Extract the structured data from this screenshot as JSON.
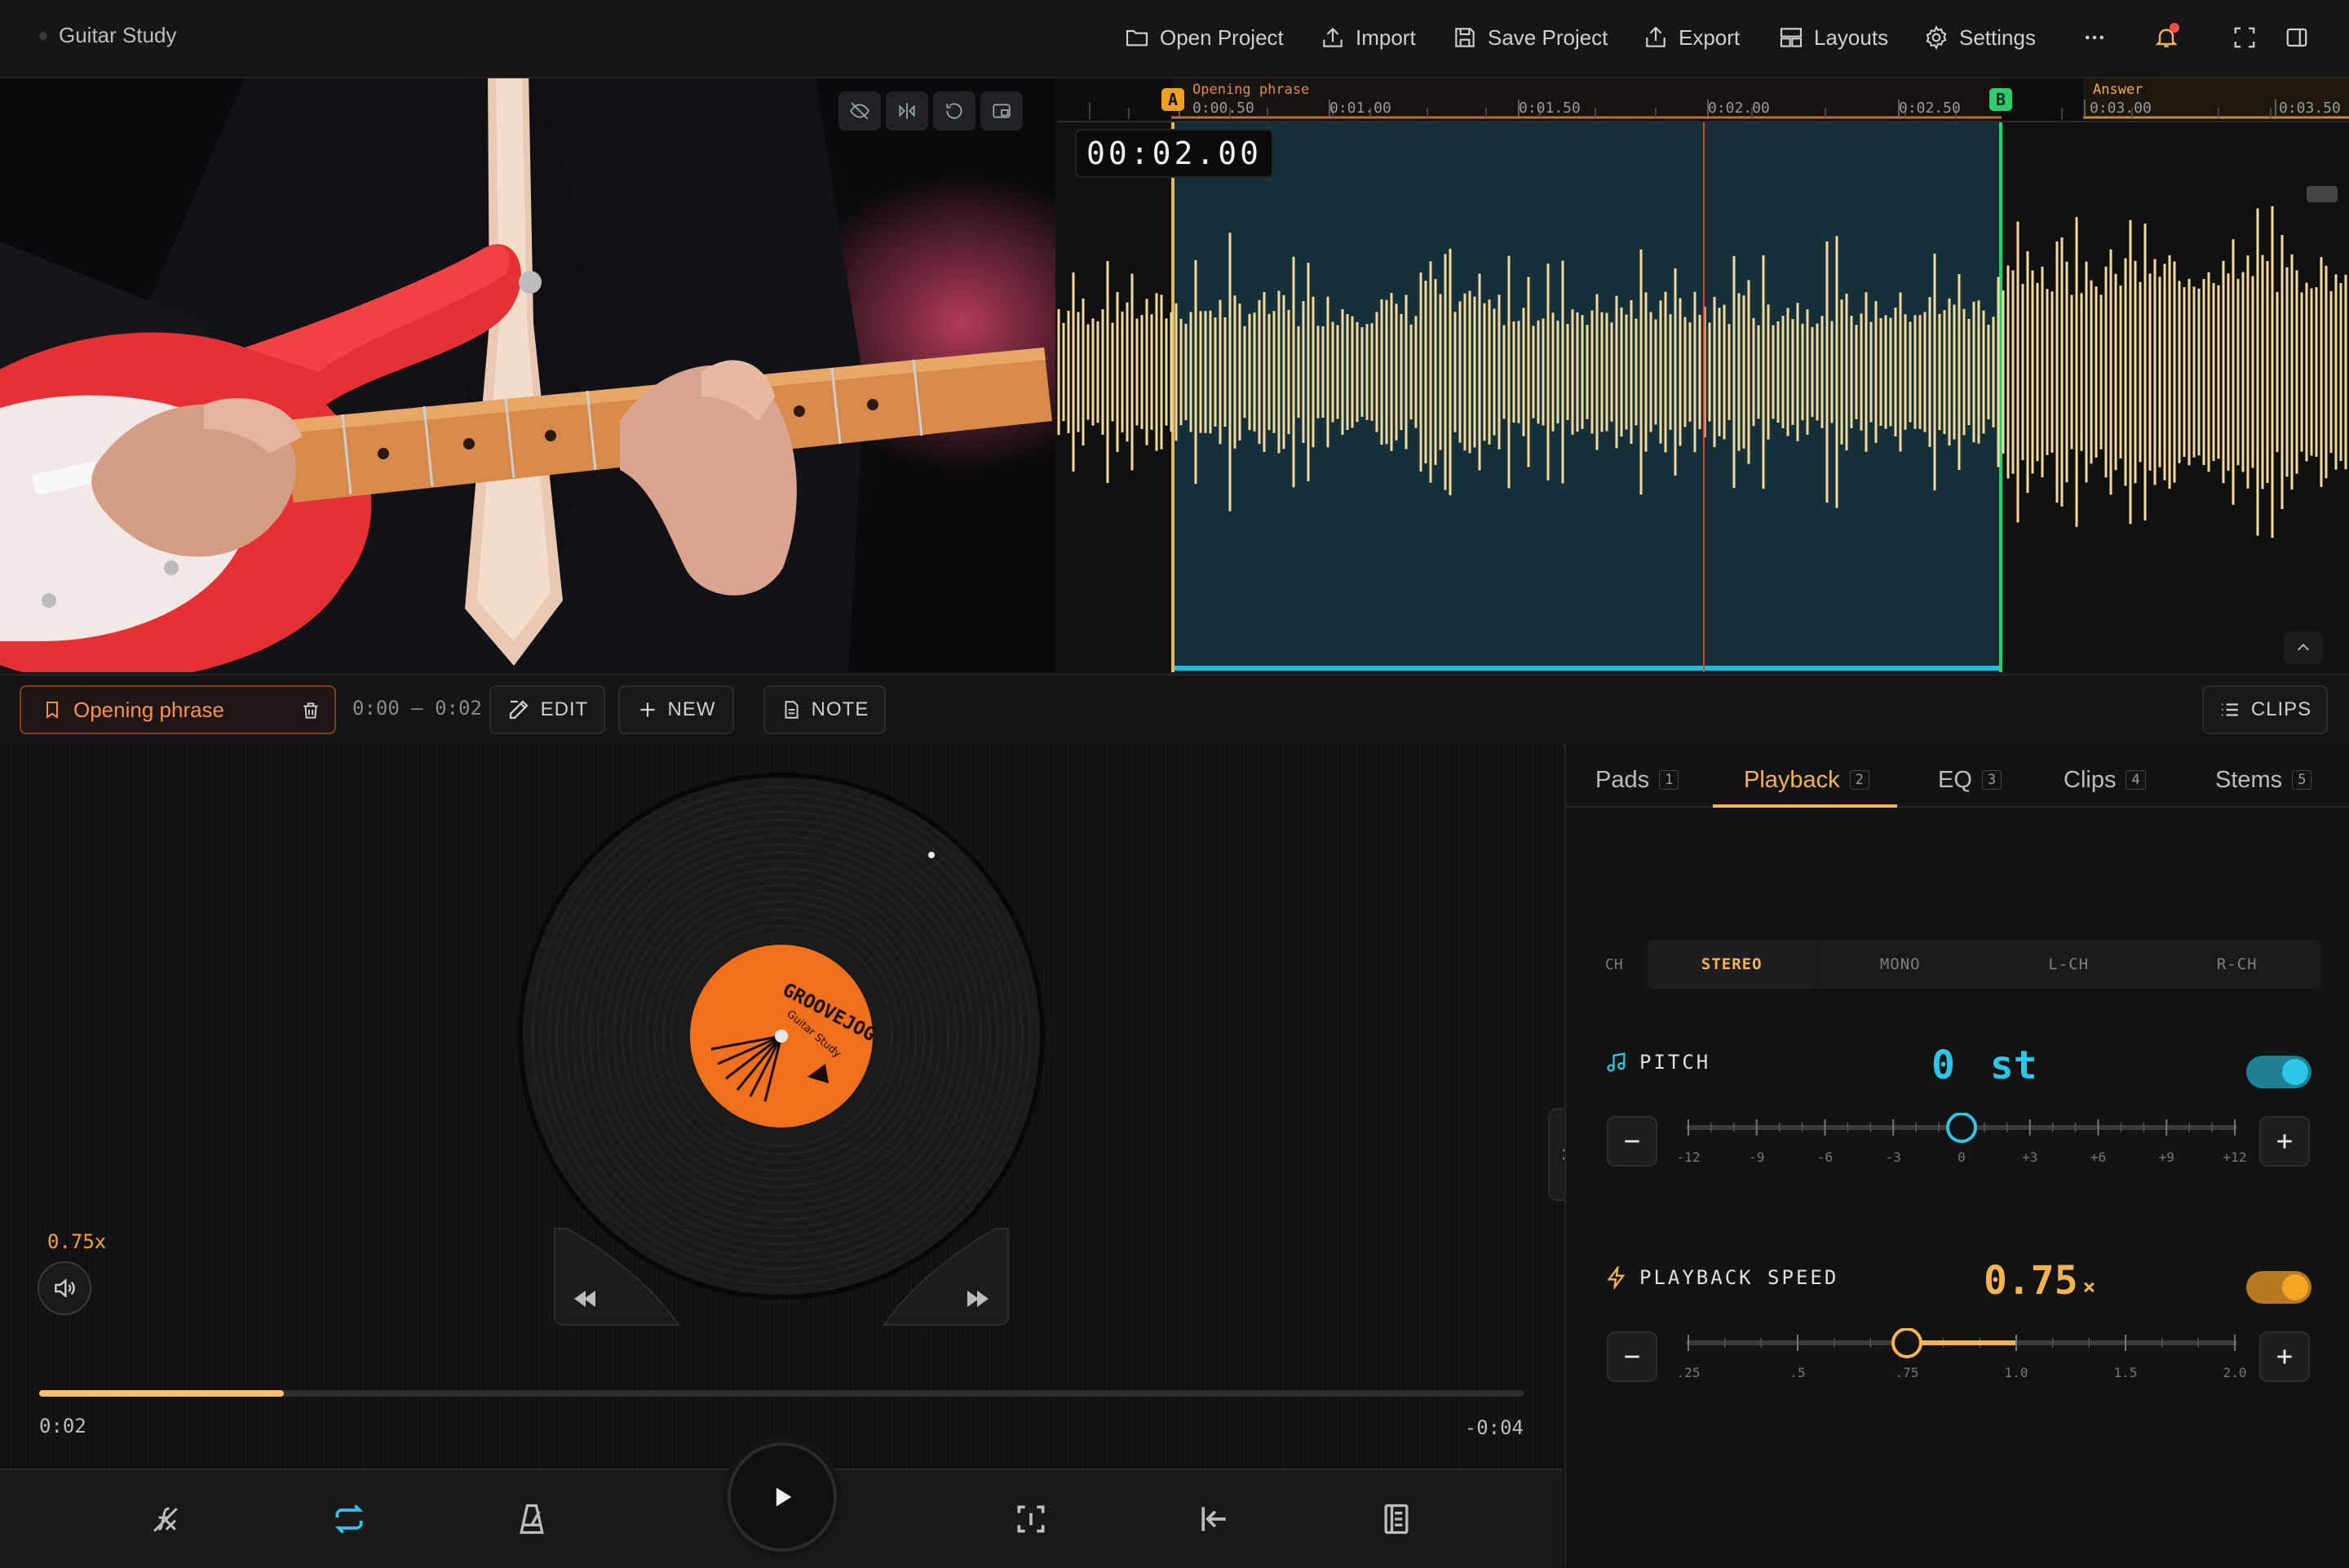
{
  "app": {
    "title": "Guitar Study"
  },
  "toolbar": {
    "open_project": "Open Project",
    "import": "Import",
    "save_project": "Save Project",
    "export": "Export",
    "layouts": "Layouts",
    "settings": "Settings"
  },
  "timeline": {
    "timecode": "00:02.00",
    "marker_a": "A",
    "marker_b": "B",
    "region_label": "Opening phrase",
    "answer_label": "Answer",
    "ruler_labels": [
      "0:00.50",
      "0:01.00",
      "0:01.50",
      "0:02.00",
      "0:02.50",
      "0:03.00",
      "0:03.50"
    ]
  },
  "clip": {
    "name": "Opening phrase",
    "range": "0:00 – 0:02",
    "edit": "EDIT",
    "new": "NEW",
    "note": "NOTE",
    "clips": "CLIPS"
  },
  "record": {
    "label_brand": "GROOVEJOG",
    "label_sub": "Guitar Study"
  },
  "player": {
    "speed_chip": "0.75x",
    "elapsed": "0:02",
    "remaining": "-0:04",
    "progress": 0.165
  },
  "tabs": [
    {
      "label": "Pads",
      "num": "1"
    },
    {
      "label": "Playback",
      "num": "2"
    },
    {
      "label": "EQ",
      "num": "3"
    },
    {
      "label": "Clips",
      "num": "4"
    },
    {
      "label": "Stems",
      "num": "5"
    }
  ],
  "channel": {
    "label": "CH",
    "options": [
      "STEREO",
      "MONO",
      "L-CH",
      "R-CH"
    ],
    "selected": "STEREO"
  },
  "pitch": {
    "label": "PITCH",
    "value": "0",
    "unit": "st",
    "enabled": true,
    "ticks": [
      "-12",
      "-9",
      "-6",
      "-3",
      "0",
      "+3",
      "+6",
      "+9",
      "+12"
    ],
    "current": 0,
    "min": -12,
    "max": 12
  },
  "speed": {
    "label": "PLAYBACK SPEED",
    "value": "0.75",
    "unit": "×",
    "enabled": true,
    "ticks": [
      ".25",
      ".5",
      ".75",
      "1.0",
      "1.5",
      "2.0"
    ],
    "current_index": 2
  },
  "colors": {
    "accent_orange": "#f5b453",
    "accent_cyan": "#2bc6e8",
    "waveform": "#f3d99a",
    "loop_region": "#16303a",
    "marker_b": "#2ecc71",
    "playhead": "#e0413c"
  }
}
